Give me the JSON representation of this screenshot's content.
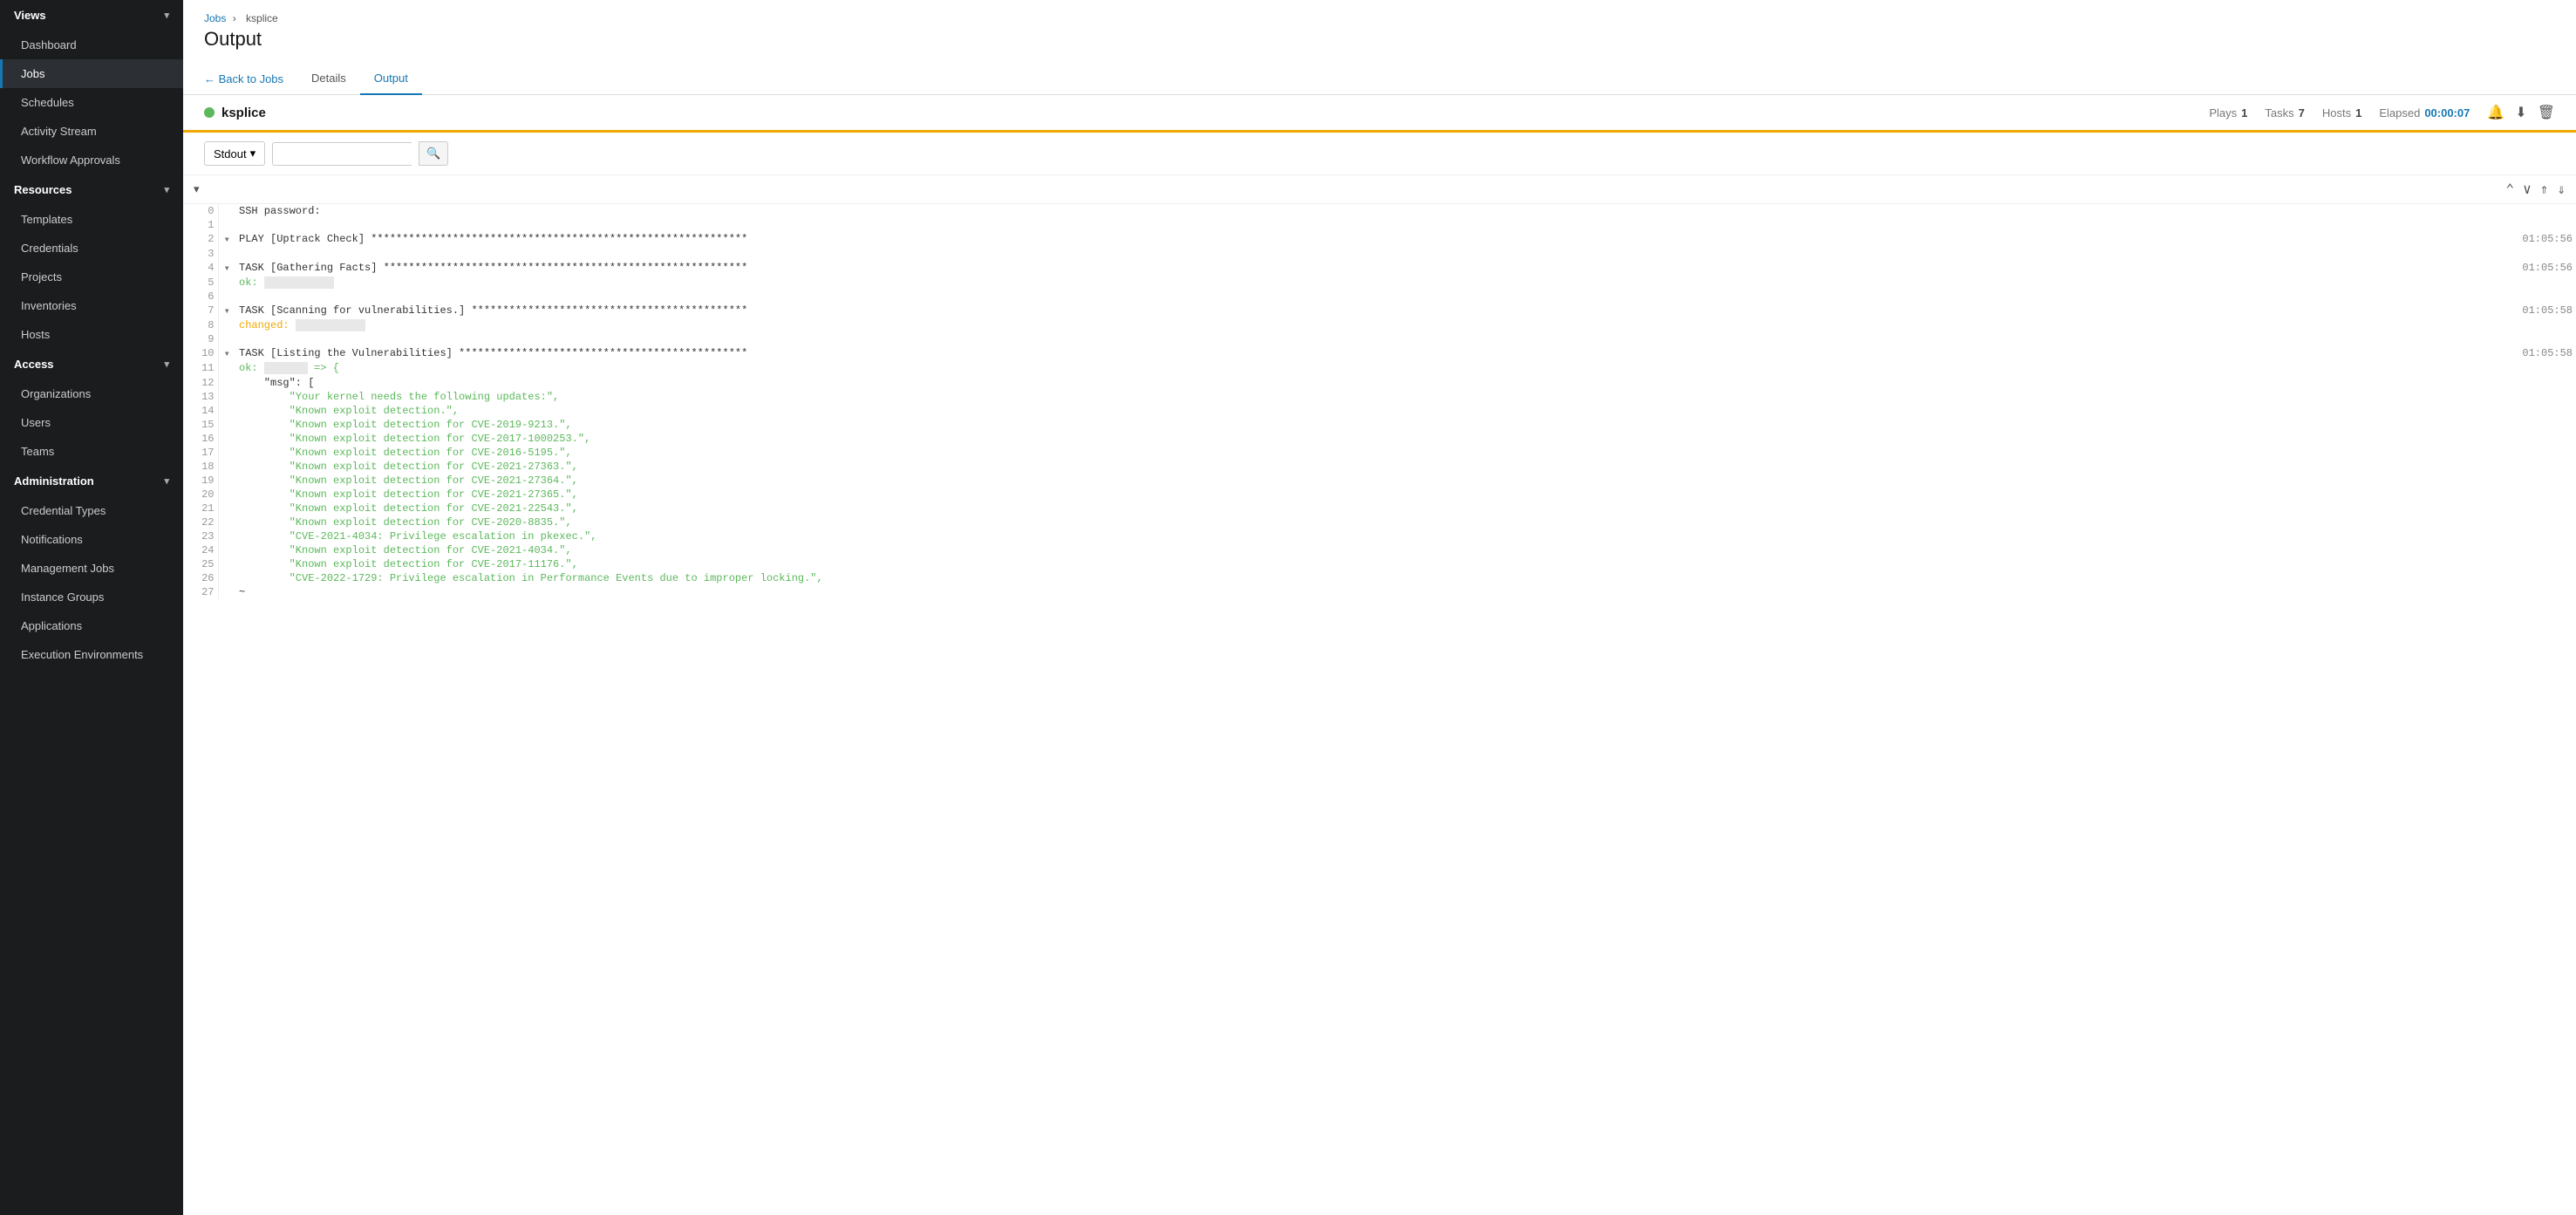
{
  "sidebar": {
    "views_label": "Views",
    "items_views": [
      {
        "id": "dashboard",
        "label": "Dashboard",
        "active": false
      },
      {
        "id": "jobs",
        "label": "Jobs",
        "active": true
      },
      {
        "id": "schedules",
        "label": "Schedules",
        "active": false
      },
      {
        "id": "activity-stream",
        "label": "Activity Stream",
        "active": false
      },
      {
        "id": "workflow-approvals",
        "label": "Workflow Approvals",
        "active": false
      }
    ],
    "resources_label": "Resources",
    "items_resources": [
      {
        "id": "templates",
        "label": "Templates",
        "active": false
      },
      {
        "id": "credentials",
        "label": "Credentials",
        "active": false
      },
      {
        "id": "projects",
        "label": "Projects",
        "active": false
      },
      {
        "id": "inventories",
        "label": "Inventories",
        "active": false
      },
      {
        "id": "hosts",
        "label": "Hosts",
        "active": false
      }
    ],
    "access_label": "Access",
    "items_access": [
      {
        "id": "organizations",
        "label": "Organizations",
        "active": false
      },
      {
        "id": "users",
        "label": "Users",
        "active": false
      },
      {
        "id": "teams",
        "label": "Teams",
        "active": false
      }
    ],
    "administration_label": "Administration",
    "items_admin": [
      {
        "id": "credential-types",
        "label": "Credential Types",
        "active": false
      },
      {
        "id": "notifications",
        "label": "Notifications",
        "active": false
      },
      {
        "id": "management-jobs",
        "label": "Management Jobs",
        "active": false
      },
      {
        "id": "instance-groups",
        "label": "Instance Groups",
        "active": false
      },
      {
        "id": "applications",
        "label": "Applications",
        "active": false
      },
      {
        "id": "execution-environments",
        "label": "Execution Environments",
        "active": false
      }
    ]
  },
  "breadcrumb": {
    "jobs_label": "Jobs",
    "current_label": "ksplice"
  },
  "page": {
    "title": "Output"
  },
  "tabs": {
    "back_label": "← Back to Jobs",
    "details_label": "Details",
    "output_label": "Output"
  },
  "job": {
    "name": "ksplice",
    "status_color": "#5cb85c",
    "plays_label": "Plays",
    "plays_value": "1",
    "tasks_label": "Tasks",
    "tasks_value": "7",
    "hosts_label": "Hosts",
    "hosts_value": "1",
    "elapsed_label": "Elapsed",
    "elapsed_value": "00:00:07"
  },
  "stdout": {
    "filter_label": "Stdout",
    "search_placeholder": ""
  },
  "log_lines": [
    {
      "num": "0",
      "toggle": "",
      "content": "SSH password:",
      "class": "",
      "timestamp": ""
    },
    {
      "num": "1",
      "toggle": "",
      "content": "",
      "class": "",
      "timestamp": ""
    },
    {
      "num": "2",
      "toggle": "▾",
      "content": "PLAY [Uptrack Check] ************************************************************",
      "class": "play",
      "timestamp": "01:05:56"
    },
    {
      "num": "3",
      "toggle": "",
      "content": "",
      "class": "",
      "timestamp": ""
    },
    {
      "num": "4",
      "toggle": "▾",
      "content": "TASK [Gathering Facts] **********************************************************",
      "class": "task",
      "timestamp": "01:05:56"
    },
    {
      "num": "5",
      "toggle": "",
      "content": "ok:",
      "class": "ok",
      "timestamp": ""
    },
    {
      "num": "6",
      "toggle": "",
      "content": "",
      "class": "",
      "timestamp": ""
    },
    {
      "num": "7",
      "toggle": "▾",
      "content": "TASK [Scanning for vulnerabilities.] ********************************************",
      "class": "task",
      "timestamp": "01:05:58"
    },
    {
      "num": "8",
      "toggle": "",
      "content": "changed:",
      "class": "changed",
      "timestamp": ""
    },
    {
      "num": "9",
      "toggle": "",
      "content": "",
      "class": "",
      "timestamp": ""
    },
    {
      "num": "10",
      "toggle": "▾",
      "content": "TASK [Listing the Vulnerabilities] **********************************************",
      "class": "task",
      "timestamp": "01:05:58"
    },
    {
      "num": "11",
      "toggle": "",
      "content": "ok:",
      "class": "ok",
      "timestamp": ""
    },
    {
      "num": "12",
      "toggle": "",
      "content": "    \"msg\": [",
      "class": "json-key",
      "timestamp": ""
    },
    {
      "num": "13",
      "toggle": "",
      "content": "        \"Your kernel needs the following updates:\",",
      "class": "json-str",
      "timestamp": ""
    },
    {
      "num": "14",
      "toggle": "",
      "content": "        \"Known exploit detection.\",",
      "class": "json-str",
      "timestamp": ""
    },
    {
      "num": "15",
      "toggle": "",
      "content": "        \"Known exploit detection for CVE-2019-9213.\",",
      "class": "json-str",
      "timestamp": ""
    },
    {
      "num": "16",
      "toggle": "",
      "content": "        \"Known exploit detection for CVE-2017-1000253.\",",
      "class": "json-str",
      "timestamp": ""
    },
    {
      "num": "17",
      "toggle": "",
      "content": "        \"Known exploit detection for CVE-2016-5195.\",",
      "class": "json-str",
      "timestamp": ""
    },
    {
      "num": "18",
      "toggle": "",
      "content": "        \"Known exploit detection for CVE-2021-27363.\",",
      "class": "json-str",
      "timestamp": ""
    },
    {
      "num": "19",
      "toggle": "",
      "content": "        \"Known exploit detection for CVE-2021-27364.\",",
      "class": "json-str",
      "timestamp": ""
    },
    {
      "num": "20",
      "toggle": "",
      "content": "        \"Known exploit detection for CVE-2021-27365.\",",
      "class": "json-str",
      "timestamp": ""
    },
    {
      "num": "21",
      "toggle": "",
      "content": "        \"Known exploit detection for CVE-2021-22543.\",",
      "class": "json-str",
      "timestamp": ""
    },
    {
      "num": "22",
      "toggle": "",
      "content": "        \"Known exploit detection for CVE-2020-8835.\",",
      "class": "json-str",
      "timestamp": ""
    },
    {
      "num": "23",
      "toggle": "",
      "content": "        \"CVE-2021-4034: Privilege escalation in pkexec.\",",
      "class": "json-str",
      "timestamp": ""
    },
    {
      "num": "24",
      "toggle": "",
      "content": "        \"Known exploit detection for CVE-2021-4034.\",",
      "class": "json-str",
      "timestamp": ""
    },
    {
      "num": "25",
      "toggle": "",
      "content": "        \"Known exploit detection for CVE-2017-11176.\",",
      "class": "json-str",
      "timestamp": ""
    },
    {
      "num": "26",
      "toggle": "",
      "content": "        \"CVE-2022-1729: Privilege escalation in Performance Events due to improper locking.\",",
      "class": "json-str",
      "timestamp": ""
    },
    {
      "num": "27",
      "toggle": "",
      "content": "~",
      "class": "",
      "timestamp": ""
    }
  ]
}
